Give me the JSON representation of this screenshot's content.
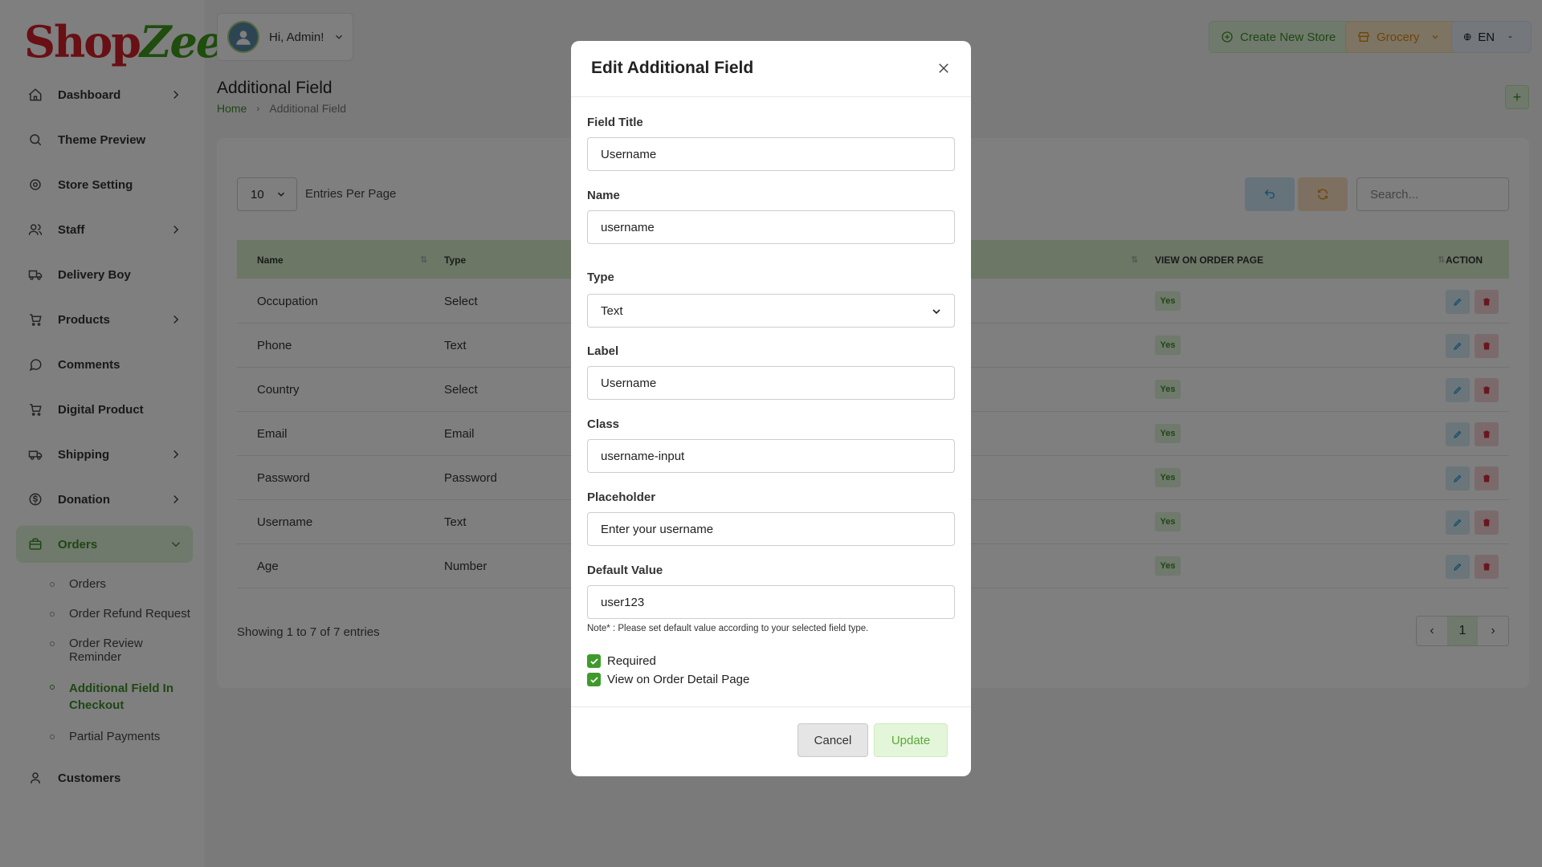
{
  "brand": {
    "logo_part1": "Shop",
    "logo_part2": "Zee",
    "logo_mark": "!"
  },
  "sidebar": {
    "items": [
      {
        "label": "Dashboard",
        "icon": "home-icon",
        "chevron": true
      },
      {
        "label": "Theme Preview",
        "icon": "theme-icon",
        "chevron": false
      },
      {
        "label": "Store Setting",
        "icon": "gear-icon",
        "chevron": false
      },
      {
        "label": "Staff",
        "icon": "users-icon",
        "chevron": true
      },
      {
        "label": "Delivery Boy",
        "icon": "truck-icon",
        "chevron": false
      },
      {
        "label": "Products",
        "icon": "cart-icon",
        "chevron": true
      },
      {
        "label": "Comments",
        "icon": "comment-icon",
        "chevron": false
      },
      {
        "label": "Digital Product",
        "icon": "cart-icon",
        "chevron": false
      },
      {
        "label": "Shipping",
        "icon": "shipping-icon",
        "chevron": true
      },
      {
        "label": "Donation",
        "icon": "dollar-icon",
        "chevron": true
      },
      {
        "label": "Orders",
        "icon": "bag-icon",
        "chevron": true,
        "active": true
      }
    ],
    "orders_submenu": [
      {
        "label": "Orders"
      },
      {
        "label": "Order Refund Request"
      },
      {
        "label": "Order Review Reminder"
      },
      {
        "label": "Additional Field In Checkout",
        "active": true
      },
      {
        "label": "Partial Payments"
      }
    ],
    "bottom_items": [
      {
        "label": "Customers",
        "icon": "user-icon"
      }
    ]
  },
  "header": {
    "greeting": "Hi, Admin!",
    "create_store": "Create New Store",
    "store_select": "Grocery",
    "language": "EN"
  },
  "page": {
    "title": "Additional Field",
    "breadcrumb_home": "Home",
    "breadcrumb_current": "Additional Field",
    "add_button": "+"
  },
  "table": {
    "per_page_value": "10",
    "per_page_label": "Entries Per Page",
    "search_placeholder": "Search...",
    "columns": {
      "name": "Name",
      "type": "Type",
      "view_on_order": "VIEW ON ORDER PAGE",
      "action": "ACTION"
    },
    "rows": [
      {
        "name": "Occupation",
        "type": "Select",
        "view": "Yes"
      },
      {
        "name": "Phone",
        "type": "Text",
        "view": "Yes"
      },
      {
        "name": "Country",
        "type": "Select",
        "view": "Yes"
      },
      {
        "name": "Email",
        "type": "Email",
        "view": "Yes"
      },
      {
        "name": "Password",
        "type": "Password",
        "view": "Yes"
      },
      {
        "name": "Username",
        "type": "Text",
        "view": "Yes"
      },
      {
        "name": "Age",
        "type": "Number",
        "view": "Yes"
      }
    ],
    "showing": "Showing 1 to 7 of 7 entries",
    "current_page": "1"
  },
  "modal": {
    "title": "Edit Additional Field",
    "fields": {
      "field_title": {
        "label": "Field Title",
        "value": "Username"
      },
      "name": {
        "label": "Name",
        "value": "username"
      },
      "type": {
        "label": "Type",
        "value": "Text"
      },
      "label": {
        "label": "Label",
        "value": "Username"
      },
      "class": {
        "label": "Class",
        "value": "username-input"
      },
      "placeholder": {
        "label": "Placeholder",
        "value": "Enter your username"
      },
      "default_value": {
        "label": "Default Value",
        "value": "user123"
      }
    },
    "note": "Note* : Please set default value according to your selected field type.",
    "required_label": "Required",
    "view_on_order_label": "View on Order Detail Page",
    "cancel": "Cancel",
    "update": "Update"
  },
  "colors": {
    "brand_green": "#3f8f28",
    "brand_red": "#d0202a",
    "accent_light_green": "#dff2d8",
    "grocery_orange": "#d98a0c"
  }
}
